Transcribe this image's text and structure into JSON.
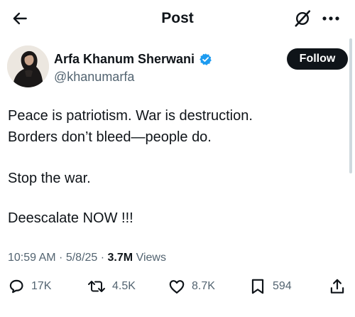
{
  "header": {
    "title": "Post",
    "back_icon": "arrow-left-icon",
    "grok_icon": "grok-icon",
    "more_icon": "more-horizontal-icon"
  },
  "author": {
    "name": "Arfa Khanum Sherwani",
    "handle": "@khanumarfa",
    "verified": true,
    "follow_label": "Follow"
  },
  "post": {
    "lines": [
      "Peace is patriotism. War is destruction.",
      "Borders don’t bleed—people do.",
      "Stop the war.",
      "Deescalate NOW !!!"
    ]
  },
  "meta": {
    "time": "10:59 AM",
    "separator": " · ",
    "date": "5/8/25",
    "views_count": "3.7M",
    "views_label": "Views"
  },
  "actions": {
    "replies": "17K",
    "reposts": "4.5K",
    "likes": "8.7K",
    "bookmarks": "594"
  },
  "colors": {
    "text_primary": "#0f1419",
    "text_secondary": "#536471",
    "verified": "#1d9bf0",
    "follow_bg": "#0f1419"
  }
}
